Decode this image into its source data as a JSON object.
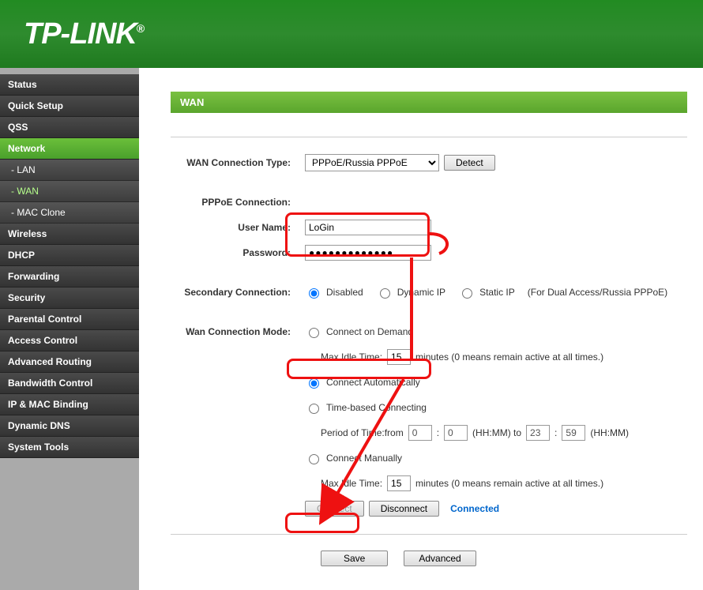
{
  "brand": "TP-LINK",
  "sidebar": {
    "items": [
      {
        "label": "Status"
      },
      {
        "label": "Quick Setup"
      },
      {
        "label": "QSS"
      },
      {
        "label": "Network",
        "active": true,
        "subs": [
          {
            "label": "- LAN"
          },
          {
            "label": "- WAN",
            "active": true
          },
          {
            "label": "- MAC Clone"
          }
        ]
      },
      {
        "label": "Wireless"
      },
      {
        "label": "DHCP"
      },
      {
        "label": "Forwarding"
      },
      {
        "label": "Security"
      },
      {
        "label": "Parental Control"
      },
      {
        "label": "Access Control"
      },
      {
        "label": "Advanced Routing"
      },
      {
        "label": "Bandwidth Control"
      },
      {
        "label": "IP & MAC Binding"
      },
      {
        "label": "Dynamic DNS"
      },
      {
        "label": "System Tools"
      }
    ]
  },
  "page": {
    "title": "WAN",
    "conn_type_label": "WAN Connection Type:",
    "conn_type_value": "PPPoE/Russia PPPoE",
    "detect": "Detect",
    "pppoe_label": "PPPoE Connection:",
    "username_label": "User Name:",
    "username_value": "LoGin",
    "password_label": "Password:",
    "password_value": "●●●●●●●●●●●●●",
    "secondary_label": "Secondary Connection:",
    "sec_disabled": "Disabled",
    "sec_dynamic": "Dynamic IP",
    "sec_static": "Static IP",
    "sec_note": "(For Dual Access/Russia PPPoE)",
    "mode_label": "Wan Connection Mode:",
    "mode_demand": "Connect on Demand",
    "mode_idle_label": "Max Idle Time:",
    "mode_idle_value": "15",
    "mode_idle_note": "minutes (0 means remain active at all times.)",
    "mode_auto": "Connect Automatically",
    "mode_time": "Time-based Connecting",
    "period_label": "Period of Time:from",
    "period_h1": "0",
    "period_m1": "0",
    "period_hhmm": "(HH:MM) to",
    "period_h2": "23",
    "period_m2": "59",
    "period_hhmm2": "(HH:MM)",
    "mode_manual": "Connect Manually",
    "mode_idle2_value": "15",
    "connect": "Connect",
    "disconnect": "Disconnect",
    "connected": "Connected",
    "save": "Save",
    "advanced": "Advanced"
  }
}
